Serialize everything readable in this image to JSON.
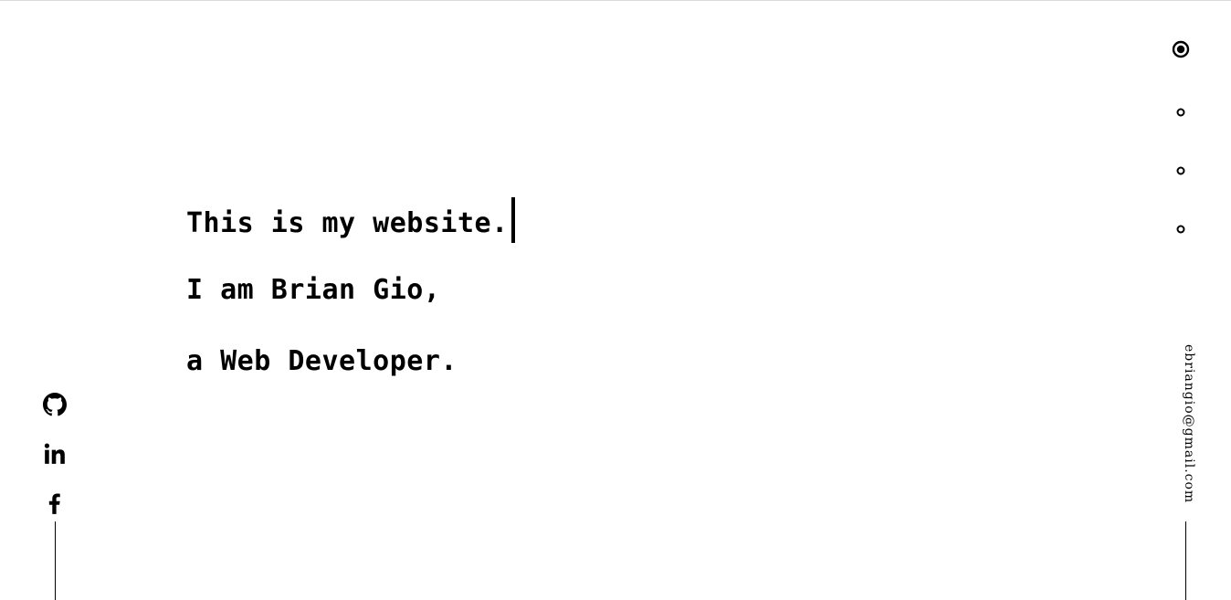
{
  "hero": {
    "lines": [
      "This is my website.",
      "I am Brian Gio,",
      "a Web Developer."
    ]
  },
  "social": {
    "items": [
      {
        "name": "github",
        "icon": "github-icon"
      },
      {
        "name": "linkedin",
        "icon": "linkedin-icon",
        "text": "in"
      },
      {
        "name": "facebook",
        "icon": "facebook-icon",
        "text": "f"
      }
    ]
  },
  "section_nav": {
    "active_index": 0,
    "count": 4
  },
  "contact": {
    "email": "ebriangio@gmail.com"
  },
  "colors": {
    "foreground": "#000000",
    "background": "#ffffff",
    "top_border": "#d9d9d9"
  }
}
